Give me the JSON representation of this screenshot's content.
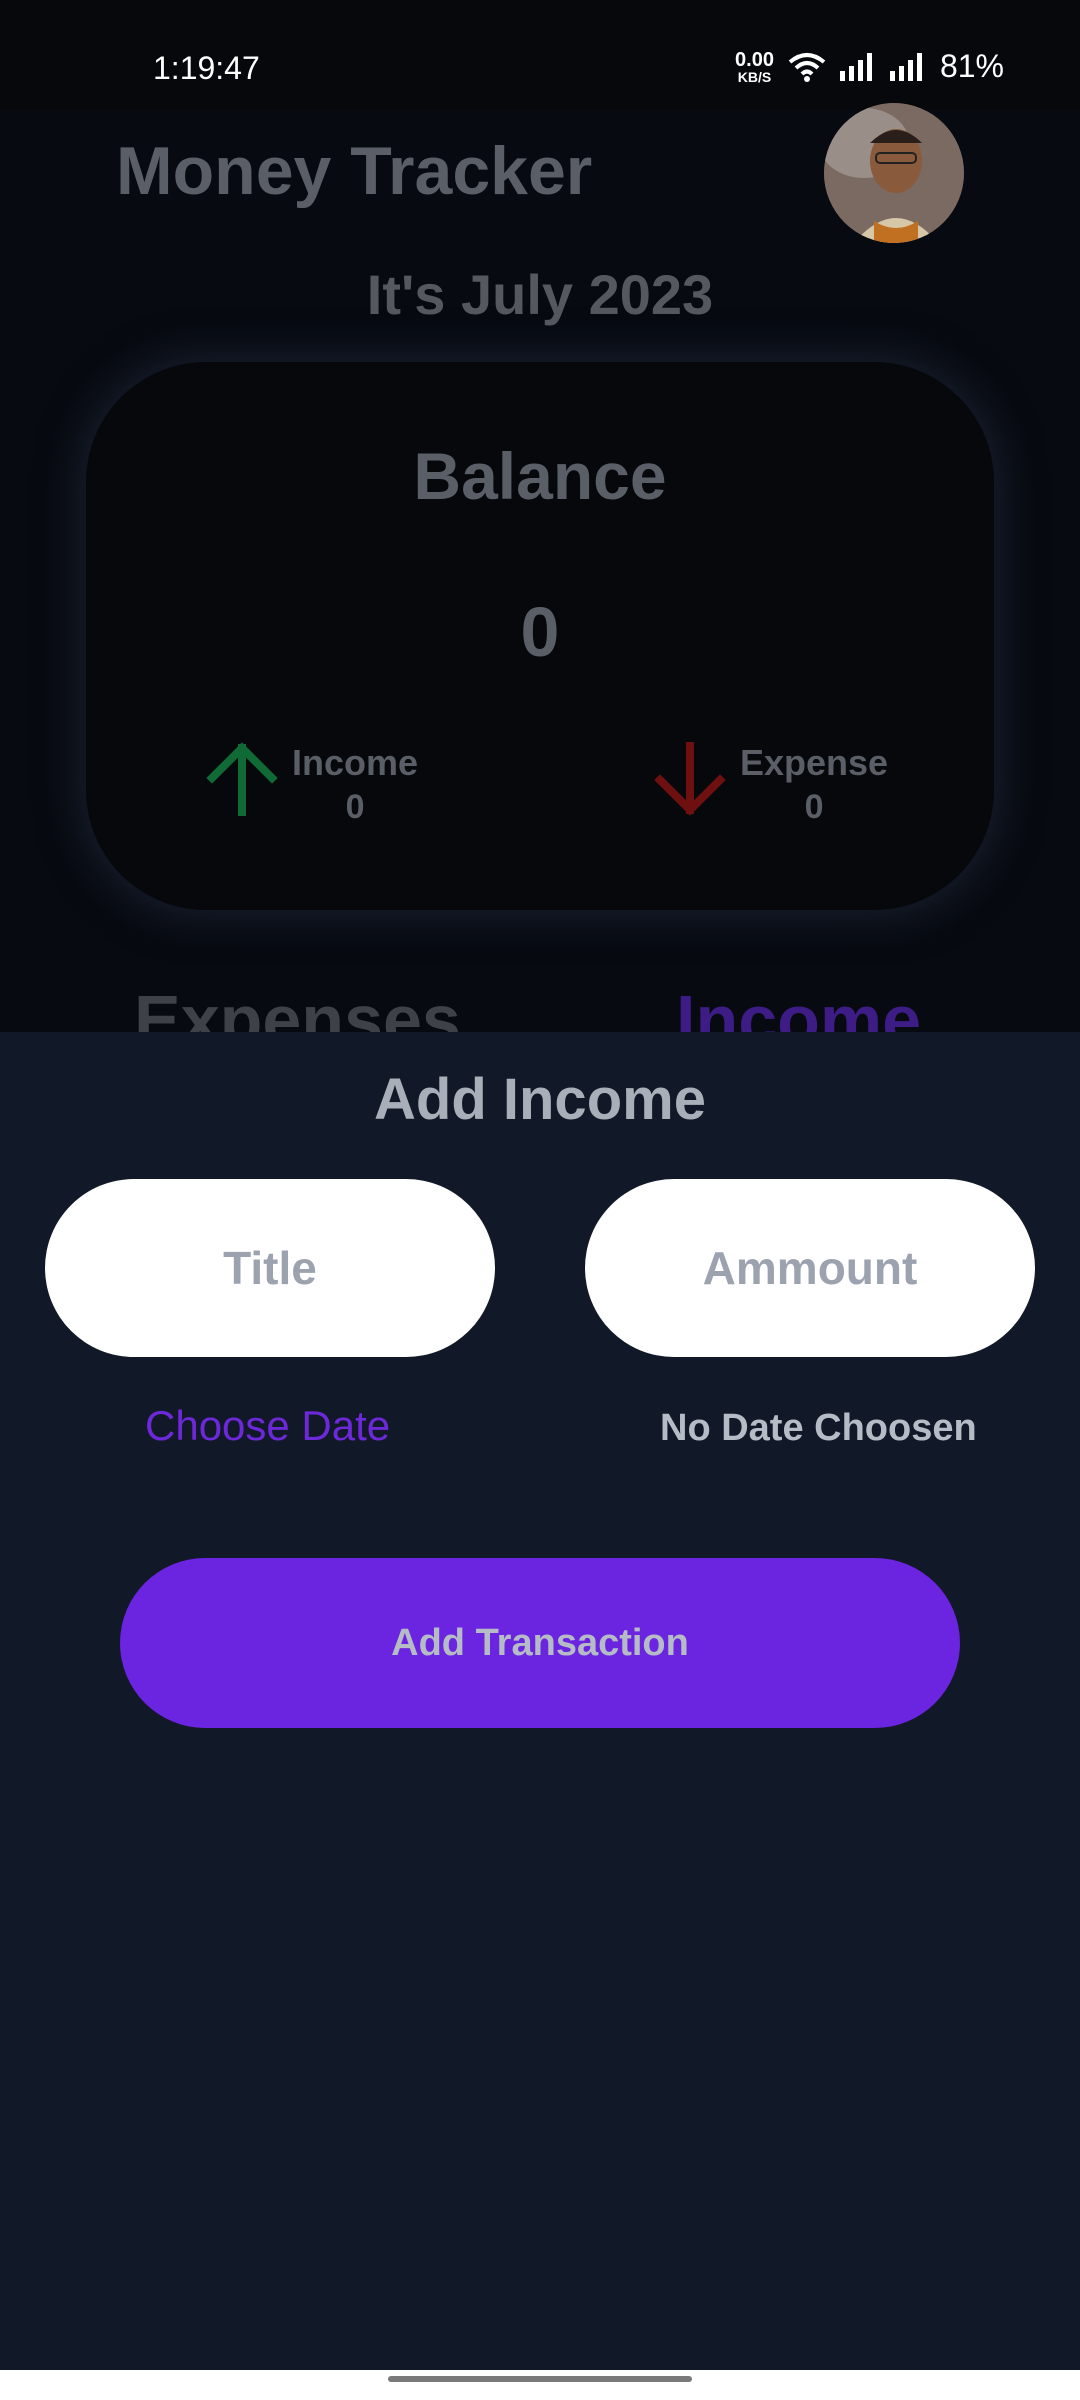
{
  "status_bar": {
    "time": "1:19:47",
    "net_speed_value": "0.00",
    "net_speed_unit": "KB/S",
    "battery": "81%"
  },
  "header": {
    "app_title": "Money Tracker",
    "month_title": "It's July 2023"
  },
  "balance_card": {
    "label": "Balance",
    "value": "0",
    "income_label": "Income",
    "income_value": "0",
    "expense_label": "Expense",
    "expense_value": "0"
  },
  "tabs": {
    "expenses_label": "Expenses",
    "income_label": "Income"
  },
  "sheet": {
    "title": "Add Income",
    "title_placeholder": "Title",
    "amount_placeholder": "Ammount",
    "choose_date_label": "Choose Date",
    "date_status": "No Date Choosen",
    "submit_label": "Add Transaction"
  },
  "colors": {
    "accent": "#6b24e0",
    "income_arrow": "#0f6a35",
    "expense_arrow": "#6e1010",
    "sheet_bg": "#111827"
  },
  "icons": {
    "income": "arrow-up-icon",
    "expense": "arrow-down-icon",
    "wifi": "wifi-icon",
    "signal": "signal-icon"
  }
}
